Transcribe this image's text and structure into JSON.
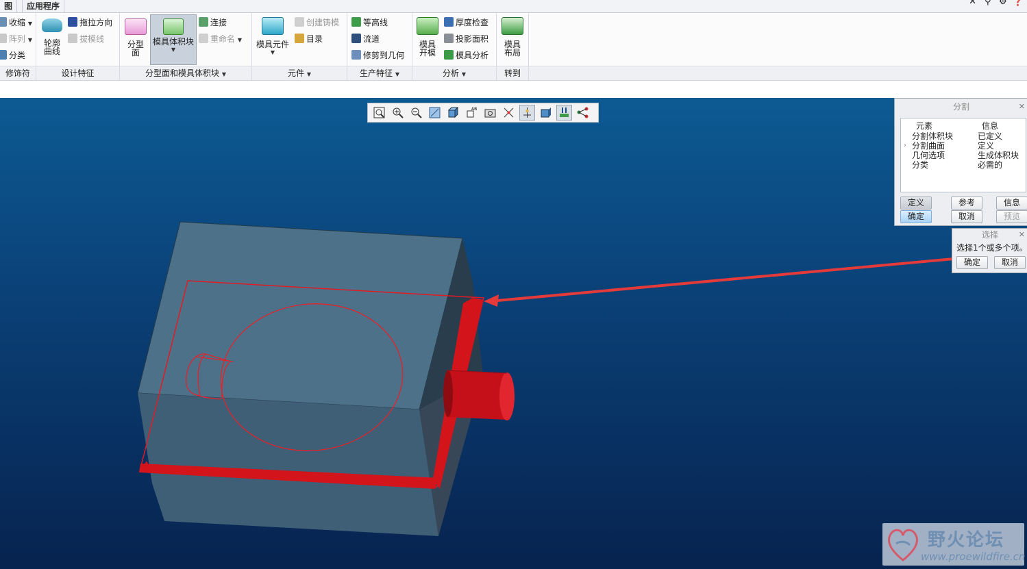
{
  "tabs": [
    "图",
    "应用程序"
  ],
  "window_controls": [
    "close-x-icon",
    "search-icon",
    "settings-icon",
    "help-icon"
  ],
  "ribbon": {
    "group0": {
      "title": "修饰符",
      "items": [
        {
          "label": "收缩",
          "has_menu": true
        },
        {
          "label": "阵列",
          "has_menu": true,
          "disabled": true
        },
        {
          "label": "分类"
        }
      ]
    },
    "group1": {
      "title": "设计特征",
      "big": {
        "label_line1": "轮廓",
        "label_line2": "曲线"
      },
      "items": [
        {
          "label": "拖拉方向"
        },
        {
          "label": "拔模线",
          "disabled": true
        }
      ]
    },
    "group2": {
      "title": "分型面和模具体积块",
      "big1": {
        "label_line1": "分型",
        "label_line2": "面"
      },
      "big2": {
        "label": "模具体积块"
      },
      "items": [
        {
          "label": "连接"
        },
        {
          "label": "重命名",
          "disabled": true
        }
      ]
    },
    "group3": {
      "title": "元件",
      "big": {
        "label": "模具元件"
      },
      "items": [
        {
          "label": "创建铸模",
          "disabled": true
        },
        {
          "label": "目录"
        }
      ]
    },
    "group4": {
      "title": "生产特征",
      "items": [
        {
          "label": "等高线"
        },
        {
          "label": "流道"
        },
        {
          "label": "修剪到几何"
        }
      ]
    },
    "group5": {
      "title": "分析",
      "big": {
        "label_line1": "模具",
        "label_line2": "开模"
      },
      "items": [
        {
          "label": "厚度检查"
        },
        {
          "label": "投影面积"
        },
        {
          "label": "模具分析"
        }
      ]
    },
    "group6": {
      "title": "转到",
      "big": {
        "label_line1": "模具",
        "label_line2": "布局"
      }
    }
  },
  "view_toolbar": {
    "icons": [
      "zoom-fit-icon",
      "zoom-in-icon",
      "zoom-out-icon",
      "repaint-icon",
      "display-style-icon",
      "named-view-icon",
      "snapshot-icon",
      "datum-display-icon",
      "spin-center-icon",
      "view-normal-icon",
      "annotation-display-icon",
      "model-tree-icon"
    ],
    "active": [
      "spin-center-icon",
      "annotation-display-icon"
    ]
  },
  "split_dialog": {
    "title": "分割",
    "columns": [
      "元素",
      "信息"
    ],
    "rows": [
      {
        "element": "分割体积块",
        "info": "已定义"
      },
      {
        "element": "分割曲面",
        "info": "定义",
        "current": true
      },
      {
        "element": "几何选项",
        "info": "生成体积块"
      },
      {
        "element": "分类",
        "info": "必需的"
      }
    ],
    "buttons": {
      "define": "定义",
      "refs": "参考",
      "info": "信息",
      "ok": "确定",
      "cancel": "取消",
      "preview": "预览"
    }
  },
  "select_dialog": {
    "title": "选择",
    "prompt": "选择1个或多个项。",
    "ok": "确定",
    "cancel": "取消"
  },
  "watermark": {
    "title": "野火论坛",
    "url": "www.proewildfire.cn"
  },
  "colors": {
    "viewport_top": "#0d5a93",
    "viewport_bottom": "#07234f",
    "highlight_red": "#e11b22",
    "model_face": "#4a6e86"
  }
}
